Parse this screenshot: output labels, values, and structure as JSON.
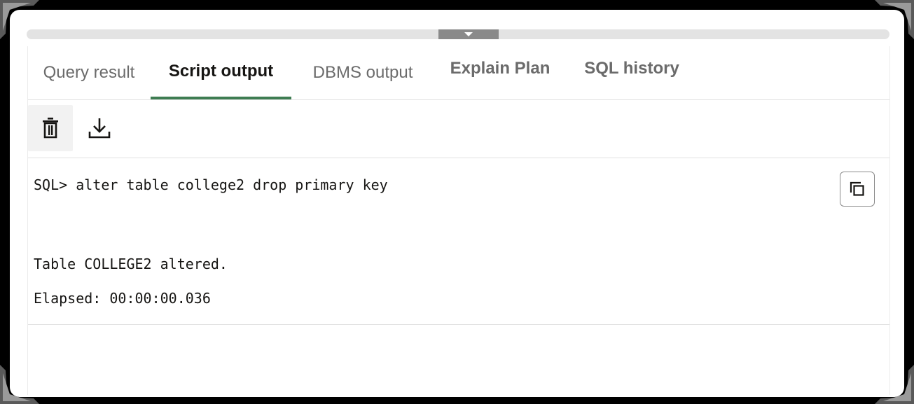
{
  "tabs": [
    {
      "label": "Query result",
      "active": false
    },
    {
      "label": "Script output",
      "active": true
    },
    {
      "label": "DBMS output",
      "active": false
    },
    {
      "label": "Explain Plan",
      "active": false
    },
    {
      "label": "SQL history",
      "active": false
    }
  ],
  "toolbar": {
    "clear_icon": "trash-icon",
    "download_icon": "download-icon"
  },
  "output": {
    "command": "SQL> alter table college2 drop primary key",
    "result": "Table COLLEGE2 altered.",
    "elapsed": "Elapsed: 00:00:00.036",
    "copy_icon": "copy-icon"
  },
  "colors": {
    "active_tab_underline": "#3e7d52",
    "inactive_tab_text": "#6b6b6b",
    "active_tab_text": "#161513"
  }
}
